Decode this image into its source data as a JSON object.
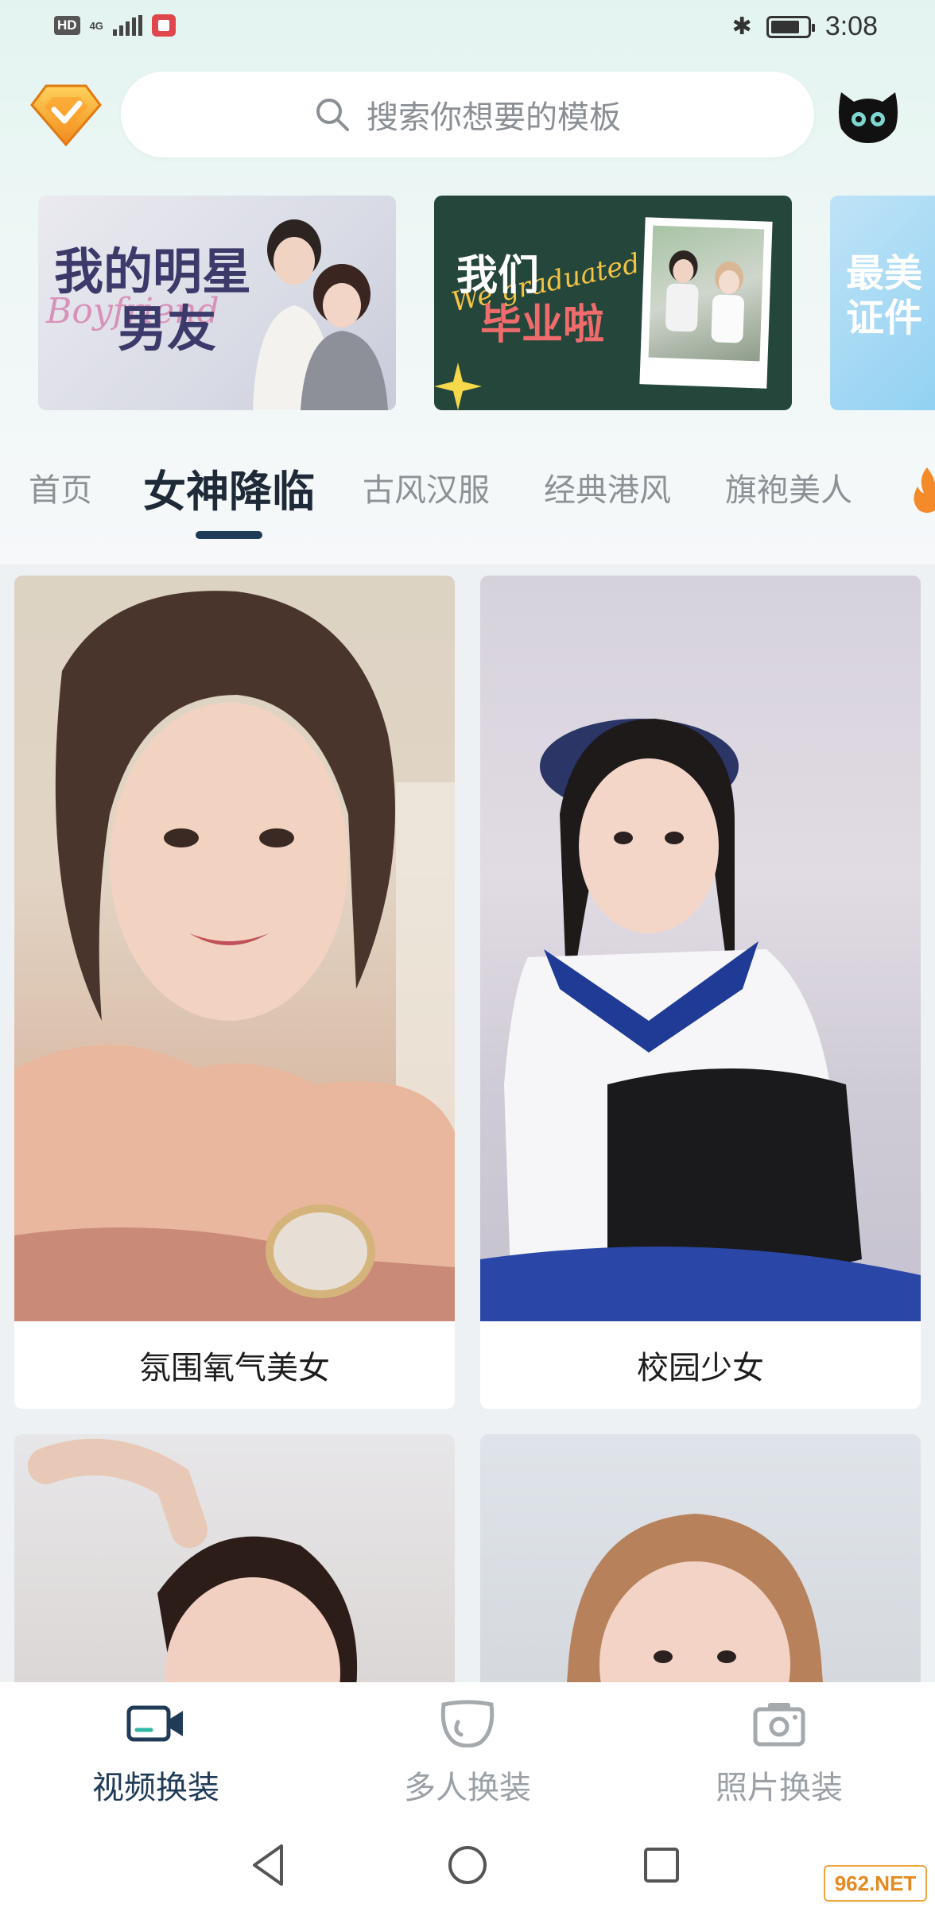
{
  "status_bar": {
    "hd": "HD",
    "network": "4G",
    "time": "3:08",
    "battery_level": 0.8
  },
  "search": {
    "placeholder": "搜索你想要的模板"
  },
  "banners": [
    {
      "title_line1": "我的明星",
      "title_line2": "男友",
      "script": "Boyfriend"
    },
    {
      "title_line1": "我们",
      "title_line2": "毕业啦",
      "script": "We graduated"
    },
    {
      "title_line1": "最美",
      "title_line2": "证件"
    }
  ],
  "tabs": [
    {
      "label": "首页"
    },
    {
      "label": "女神降临",
      "active": true
    },
    {
      "label": "古风汉服"
    },
    {
      "label": "经典港风"
    },
    {
      "label": "旗袍美人"
    }
  ],
  "cards": [
    {
      "caption": "氛围氧气美女"
    },
    {
      "caption": "校园少女"
    },
    {
      "caption": ""
    },
    {
      "caption": ""
    }
  ],
  "bottom_nav": [
    {
      "label": "视频换装",
      "icon": "video-camera-icon",
      "active": true
    },
    {
      "label": "多人换装",
      "icon": "mask-face-icon"
    },
    {
      "label": "照片换装",
      "icon": "camera-icon"
    }
  ],
  "watermark": "962.NET",
  "colors": {
    "accent": "#1f3b57",
    "inactive": "#9aa0a6",
    "vip_gold": "#f5a623"
  }
}
